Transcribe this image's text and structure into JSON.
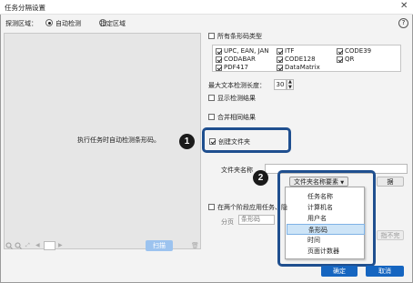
{
  "window": {
    "title": "任务分隔设置",
    "close_glyph": "✕"
  },
  "detection": {
    "label": "探测区域：",
    "options": [
      {
        "label": "自动检测",
        "selected": true
      },
      {
        "label": "指定区域",
        "selected": false
      }
    ]
  },
  "preview": {
    "message": "执行任务时自动检测条形码。",
    "scan_button": "扫描"
  },
  "help_glyph": "?",
  "barcode_types": {
    "all_label": "所有条形码类型",
    "col1": [
      "UPC, EAN, JAN",
      "CODABAR",
      "PDF417"
    ],
    "col2": [
      "ITF",
      "CODE128",
      "DataMatrix"
    ],
    "col3": [
      "CODE39",
      "QR"
    ]
  },
  "max_text": {
    "label": "最大文本检测长度：",
    "value": "30"
  },
  "options": {
    "show_results": "显示检测结果",
    "merge_same": "合并相同结果",
    "create_folder": "创建文件夹"
  },
  "folder": {
    "name_label": "文件夹名称",
    "element_button": "文件夹名称要素",
    "element_arrow": "▼",
    "partial_button": "据"
  },
  "dropdown": {
    "items": [
      "任务名称",
      "计算机名",
      "用户名",
      "条形码",
      "时间",
      "页面计数器"
    ],
    "selected_index": 3
  },
  "split_section": {
    "label": "在两个阶段应用任务、隐",
    "sub_label": "分页",
    "sub_value": "条形码",
    "right_button": "指不完"
  },
  "footer": {
    "ok": "确定",
    "cancel": "取消"
  },
  "callouts": [
    "1",
    "2"
  ],
  "colors": {
    "accent": "#1f4f8f",
    "ok_button": "#1565c0",
    "cancel_button": "#1565c0",
    "selected_item": "#cde4f7"
  }
}
